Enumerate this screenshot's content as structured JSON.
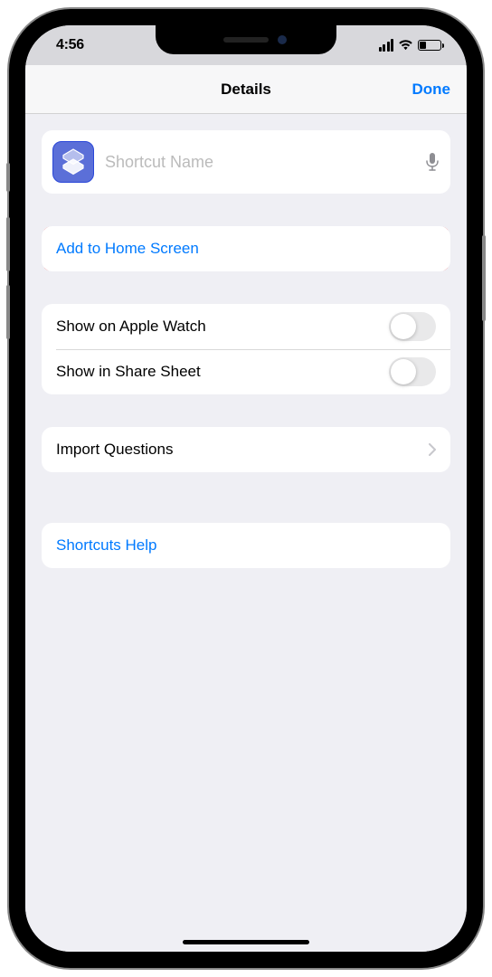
{
  "status": {
    "time": "4:56"
  },
  "nav": {
    "title": "Details",
    "done": "Done"
  },
  "name_field": {
    "placeholder": "Shortcut Name",
    "value": ""
  },
  "actions": {
    "add_home": "Add to Home Screen",
    "apple_watch": "Show on Apple Watch",
    "share_sheet": "Show in Share Sheet",
    "import_questions": "Import Questions",
    "help": "Shortcuts Help"
  }
}
